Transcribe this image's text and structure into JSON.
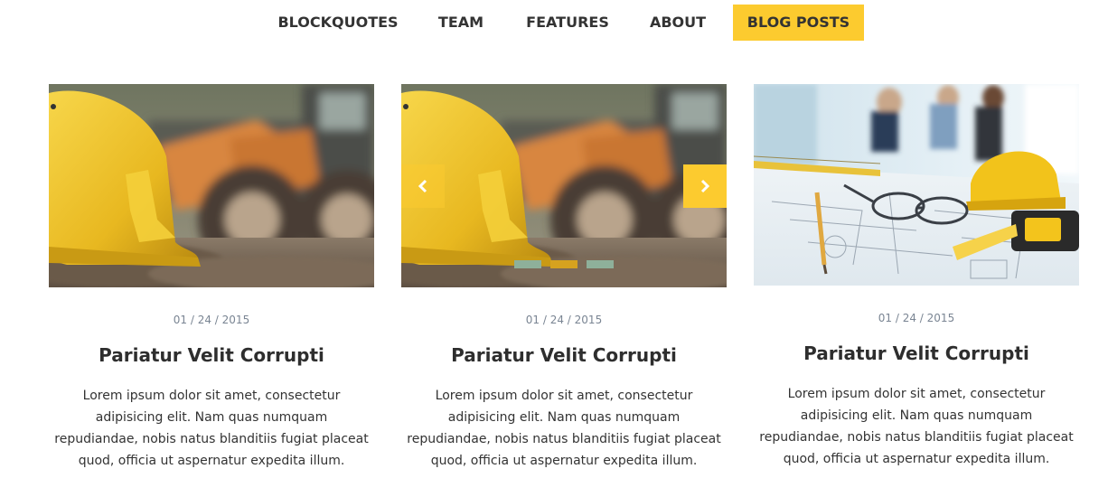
{
  "nav": {
    "items": [
      {
        "label": "BLOCKQUOTES"
      },
      {
        "label": "TEAM"
      },
      {
        "label": "FEATURES"
      },
      {
        "label": "ABOUT"
      },
      {
        "label": "BLOG POSTS",
        "active": true
      }
    ],
    "accent_color": "#fccb2f"
  },
  "posts": [
    {
      "image": "hard-hat-construction-photo",
      "date": "01 / 24 / 2015",
      "title": "Pariatur Velit Corrupti",
      "excerpt": "Lorem ipsum dolor sit amet, consectetur adipisicing elit. Nam quas numquam repudiandae, nobis natus blanditiis fugiat placeat quod, officia ut aspernatur expedita illum."
    },
    {
      "image": "hard-hat-construction-photo",
      "date": "01 / 24 / 2015",
      "title": "Pariatur Velit Corrupti",
      "excerpt": "Lorem ipsum dolor sit amet, consectetur adipisicing elit. Nam quas numquam repudiandae, nobis natus blanditiis fugiat placeat quod, officia ut aspernatur expedita illum.",
      "carousel": {
        "prev_icon": "chevron-left-icon",
        "next_icon": "chevron-right-icon",
        "slide_count": 3,
        "active_slide": 2
      }
    },
    {
      "image": "blueprints-office-photo",
      "date": "01 / 24 / 2015",
      "title": "Pariatur Velit Corrupti",
      "excerpt": "Lorem ipsum dolor sit amet, consectetur adipisicing elit. Nam quas numquam repudiandae, nobis natus blanditiis fugiat placeat quod, officia ut aspernatur expedita illum."
    }
  ]
}
